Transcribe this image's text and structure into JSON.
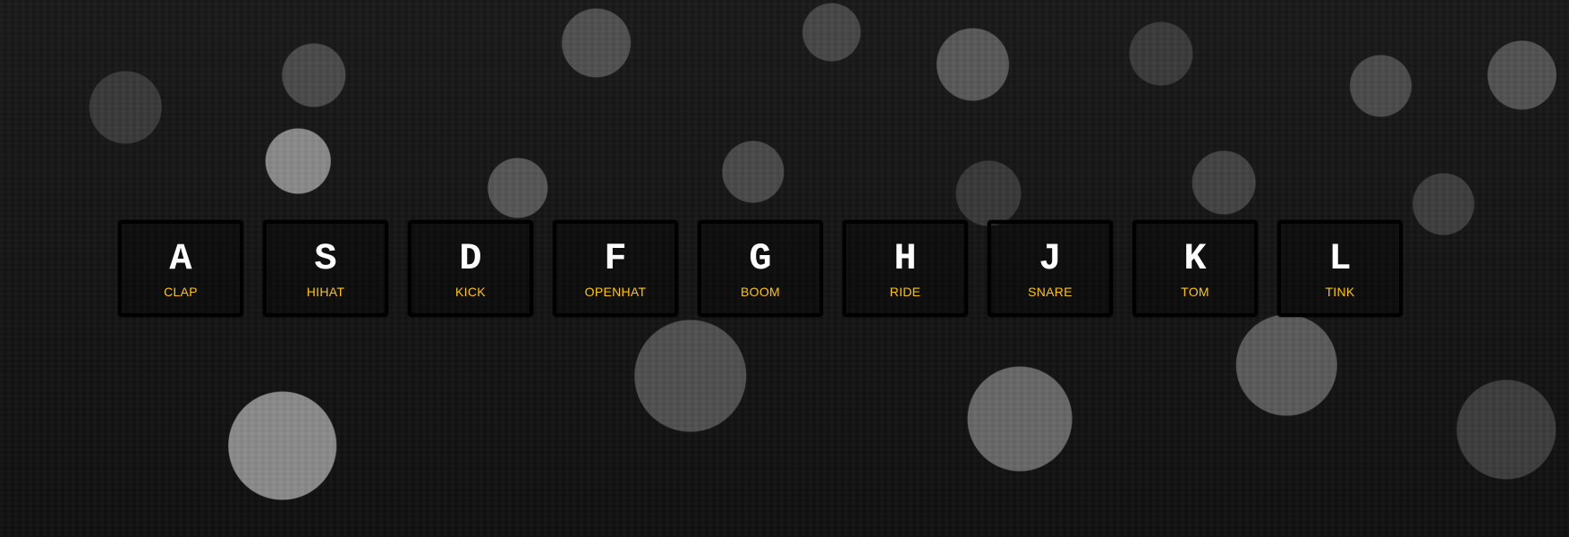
{
  "theme": {
    "accent": "#ffc600",
    "key_border": "#000000",
    "key_text": "#ffffff"
  },
  "drum_keys": [
    {
      "letter": "A",
      "sound": "CLAP"
    },
    {
      "letter": "S",
      "sound": "HIHAT"
    },
    {
      "letter": "D",
      "sound": "KICK"
    },
    {
      "letter": "F",
      "sound": "OPENHAT"
    },
    {
      "letter": "G",
      "sound": "BOOM"
    },
    {
      "letter": "H",
      "sound": "RIDE"
    },
    {
      "letter": "J",
      "sound": "SNARE"
    },
    {
      "letter": "K",
      "sound": "TOM"
    },
    {
      "letter": "L",
      "sound": "TINK"
    }
  ]
}
